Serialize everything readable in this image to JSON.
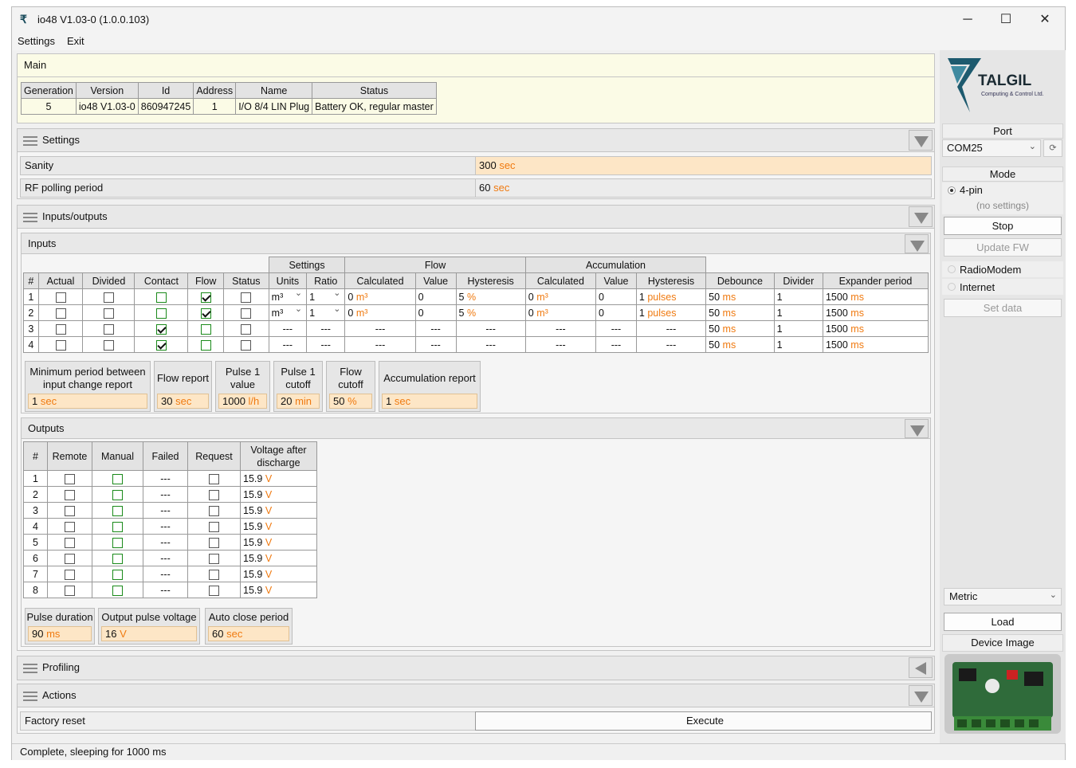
{
  "window": {
    "title": "io48 V1.03-0 (1.0.0.103)",
    "minimize": "─",
    "maximize": "☐",
    "close": "✕"
  },
  "menu": {
    "settings": "Settings",
    "exit": "Exit"
  },
  "main_panel": {
    "title": "Main",
    "headers": [
      "Generation",
      "Version",
      "Id",
      "Address",
      "Name",
      "Status"
    ],
    "row": [
      "5",
      "io48 V1.03-0",
      "860947245",
      "1",
      "I/O 8/4 LIN Plug",
      "Battery OK, regular master"
    ]
  },
  "settings_panel": {
    "title": "Settings",
    "sanity_label": "Sanity",
    "sanity_value": "300",
    "sanity_unit": "sec",
    "rf_label": "RF polling period",
    "rf_value": "60",
    "rf_unit": "sec"
  },
  "io_panel": {
    "title": "Inputs/outputs"
  },
  "inputs": {
    "title": "Inputs",
    "group_headers": {
      "settings": "Settings",
      "flow": "Flow",
      "accumulation": "Accumulation"
    },
    "headers": [
      "#",
      "Actual",
      "Divided",
      "Contact",
      "Flow",
      "Status",
      "Units",
      "Ratio",
      "Calculated",
      "Value",
      "Hysteresis",
      "Calculated",
      "Value",
      "Hysteresis",
      "Debounce",
      "Divider",
      "Expander period"
    ],
    "rows": [
      {
        "n": "1",
        "actual": false,
        "divided": false,
        "contact": false,
        "flow": true,
        "status": false,
        "units": "m³",
        "ratio": "1",
        "fcalc": "0",
        "fcalc_unit": "m³",
        "fval": "0",
        "fhyst": "5",
        "fhyst_unit": "%",
        "acalc": "0",
        "acalc_unit": "m³",
        "aval": "0",
        "ahyst": "1",
        "ahyst_unit": "pulses",
        "deb": "50",
        "deb_unit": "ms",
        "div": "1",
        "exp": "1500",
        "exp_unit": "ms"
      },
      {
        "n": "2",
        "actual": false,
        "divided": false,
        "contact": false,
        "flow": true,
        "status": false,
        "units": "m³",
        "ratio": "1",
        "fcalc": "0",
        "fcalc_unit": "m³",
        "fval": "0",
        "fhyst": "5",
        "fhyst_unit": "%",
        "acalc": "0",
        "acalc_unit": "m³",
        "aval": "0",
        "ahyst": "1",
        "ahyst_unit": "pulses",
        "deb": "50",
        "deb_unit": "ms",
        "div": "1",
        "exp": "1500",
        "exp_unit": "ms"
      },
      {
        "n": "3",
        "actual": false,
        "divided": false,
        "contact": true,
        "flow": false,
        "status": false,
        "units": "---",
        "ratio": "---",
        "fcalc": "---",
        "fval": "---",
        "fhyst": "---",
        "acalc": "---",
        "aval": "---",
        "ahyst": "---",
        "deb": "50",
        "deb_unit": "ms",
        "div": "1",
        "exp": "1500",
        "exp_unit": "ms"
      },
      {
        "n": "4",
        "actual": false,
        "divided": false,
        "contact": true,
        "flow": false,
        "status": false,
        "units": "---",
        "ratio": "---",
        "fcalc": "---",
        "fval": "---",
        "fhyst": "---",
        "acalc": "---",
        "aval": "---",
        "ahyst": "---",
        "deb": "50",
        "deb_unit": "ms",
        "div": "1",
        "exp": "1500",
        "exp_unit": "ms"
      }
    ],
    "fields": [
      {
        "label": "Minimum period between input change report",
        "value": "1",
        "unit": "sec"
      },
      {
        "label": "Flow report",
        "value": "30",
        "unit": "sec"
      },
      {
        "label": "Pulse 1 value",
        "value": "1000",
        "unit": "l/h"
      },
      {
        "label": "Pulse 1 cutoff",
        "value": "20",
        "unit": "min"
      },
      {
        "label": "Flow cutoff",
        "value": "50",
        "unit": "%"
      },
      {
        "label": "Accumulation report",
        "value": "1",
        "unit": "sec"
      }
    ]
  },
  "outputs": {
    "title": "Outputs",
    "headers": [
      "#",
      "Remote",
      "Manual",
      "Failed",
      "Request",
      "Voltage after discharge"
    ],
    "rows": [
      {
        "n": "1",
        "failed": "---",
        "voltage": "15.9",
        "unit": "V"
      },
      {
        "n": "2",
        "failed": "---",
        "voltage": "15.9",
        "unit": "V"
      },
      {
        "n": "3",
        "failed": "---",
        "voltage": "15.9",
        "unit": "V"
      },
      {
        "n": "4",
        "failed": "---",
        "voltage": "15.9",
        "unit": "V"
      },
      {
        "n": "5",
        "failed": "---",
        "voltage": "15.9",
        "unit": "V"
      },
      {
        "n": "6",
        "failed": "---",
        "voltage": "15.9",
        "unit": "V"
      },
      {
        "n": "7",
        "failed": "---",
        "voltage": "15.9",
        "unit": "V"
      },
      {
        "n": "8",
        "failed": "---",
        "voltage": "15.9",
        "unit": "V"
      }
    ],
    "fields": [
      {
        "label": "Pulse duration",
        "value": "90",
        "unit": "ms"
      },
      {
        "label": "Output pulse voltage",
        "value": "16",
        "unit": "V"
      },
      {
        "label": "Auto close period",
        "value": "60",
        "unit": "sec"
      }
    ]
  },
  "profiling": {
    "title": "Profiling"
  },
  "actions": {
    "title": "Actions",
    "factory_reset": "Factory reset",
    "execute": "Execute"
  },
  "sidebar": {
    "logo_text": "TALGIL",
    "logo_sub": "Computing & Control Ltd.",
    "port_label": "Port",
    "port_value": "COM25",
    "mode_label": "Mode",
    "mode_4pin": "4-pin",
    "no_settings": "(no settings)",
    "stop": "Stop",
    "update_fw": "Update FW",
    "radiomodem": "RadioModem",
    "internet": "Internet",
    "set_data": "Set data",
    "units_value": "Metric",
    "load": "Load",
    "device_image": "Device Image"
  },
  "status": "Complete, sleeping for 1000 ms",
  "colors": {
    "accent_orange": "#f07a10",
    "field_bg": "#fde6c6",
    "main_bg": "#fbfbe6"
  }
}
